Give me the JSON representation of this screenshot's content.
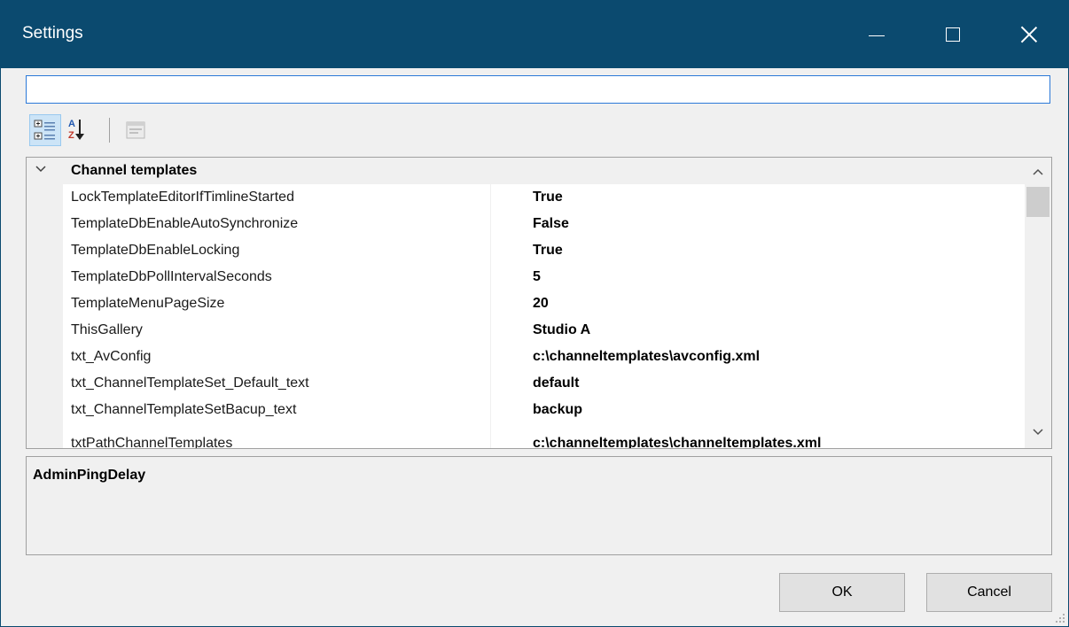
{
  "window": {
    "title": "Settings",
    "accent_color": "#0b4a6f",
    "controls": [
      "minimize-icon",
      "maximize-icon",
      "close-icon"
    ]
  },
  "search": {
    "value": "",
    "placeholder": ""
  },
  "toolbar": {
    "buttons": [
      {
        "icon": "categorized-view-icon",
        "active": true
      },
      {
        "icon": "alphabetical-sort-icon",
        "active": false
      },
      {
        "icon": "property-pages-icon",
        "enabled": false
      }
    ]
  },
  "grid": {
    "category": "Channel templates",
    "properties": [
      {
        "name": "LockTemplateEditorIfTimlineStarted",
        "value": "True"
      },
      {
        "name": "TemplateDbEnableAutoSynchronize",
        "value": "False"
      },
      {
        "name": "TemplateDbEnableLocking",
        "value": "True"
      },
      {
        "name": "TemplateDbPollIntervalSeconds",
        "value": "5"
      },
      {
        "name": "TemplateMenuPageSize",
        "value": "20"
      },
      {
        "name": "ThisGallery",
        "value": "Studio A"
      },
      {
        "name": "txt_AvConfig",
        "value": "c:\\channeltemplates\\avconfig.xml"
      },
      {
        "name": "txt_ChannelTemplateSet_Default_text",
        "value": "default"
      },
      {
        "name": "txt_ChannelTemplateSetBacup_text",
        "value": "backup"
      },
      {
        "name": "txtPathChannelTemplates",
        "value": "c:\\channeltemplates\\channeltemplates.xml"
      }
    ]
  },
  "description": {
    "title": "AdminPingDelay"
  },
  "buttons": {
    "ok": "OK",
    "cancel": "Cancel"
  }
}
